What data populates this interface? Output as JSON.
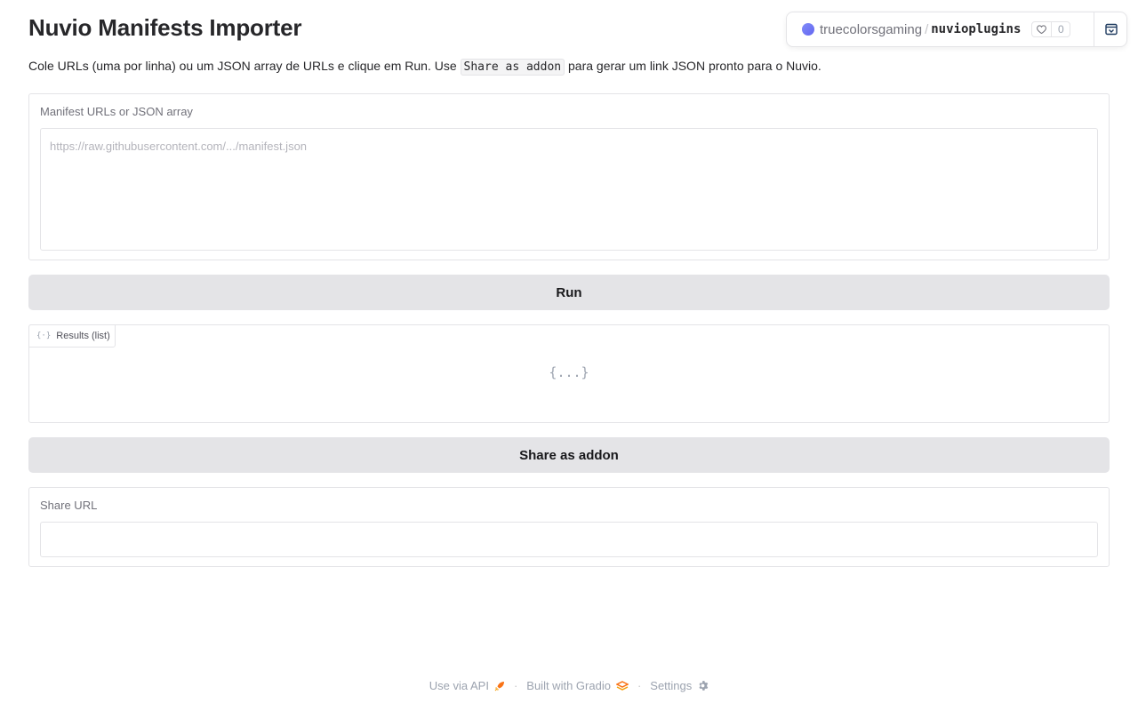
{
  "header": {
    "title": "Nuvio Manifests Importer",
    "description_before": "Cole URLs (uma por linha) ou um JSON array de URLs e clique em Run. Use ",
    "description_code": "Share as addon",
    "description_after": " para gerar um link JSON pronto para o Nuvio."
  },
  "space": {
    "owner": "truecolorsgaming",
    "separator": "/",
    "repo": "nuvioplugins",
    "likes": "0"
  },
  "manifest_input": {
    "label": "Manifest URLs or JSON array",
    "placeholder": "https://raw.githubusercontent.com/.../manifest.json",
    "value": ""
  },
  "run_button": {
    "label": "Run"
  },
  "results": {
    "tab_label": "Results (list)",
    "placeholder": "{...}"
  },
  "share_button": {
    "label": "Share as addon"
  },
  "share_url": {
    "label": "Share URL",
    "value": ""
  },
  "footer": {
    "api_label": "Use via API",
    "built_label": "Built with Gradio",
    "settings_label": "Settings",
    "separator": "·"
  },
  "colors": {
    "accent_dot": "#6366f1",
    "button_bg": "#e4e4e7",
    "gradio_orange": "#f97316"
  }
}
